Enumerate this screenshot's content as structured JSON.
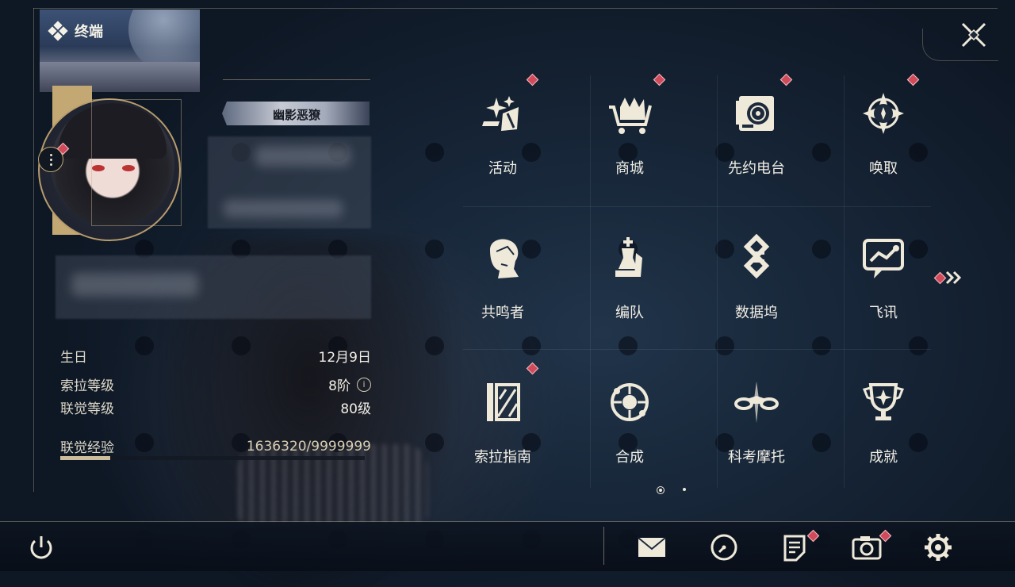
{
  "panel": {
    "title": "终端"
  },
  "profile": {
    "title_plate": "幽影恶獠"
  },
  "stats": [
    {
      "label": "生日",
      "value": "12月9日"
    },
    {
      "label": "索拉等级",
      "value": "8阶"
    },
    {
      "label": "联觉等级",
      "value": "80级"
    },
    {
      "label": "联觉经验",
      "value": "1636320/9999999"
    }
  ],
  "experience": {
    "current": 1636320,
    "max": 9999999
  },
  "menu": [
    {
      "label": "活动",
      "icon": "sparkle-icon",
      "badge": true
    },
    {
      "label": "商城",
      "icon": "shopping-cart-icon",
      "badge": true
    },
    {
      "label": "先约电台",
      "icon": "radio-icon",
      "badge": true
    },
    {
      "label": "唤取",
      "icon": "compass-star-icon",
      "badge": true
    },
    {
      "label": "共鸣者",
      "icon": "character-icon",
      "badge": false
    },
    {
      "label": "编队",
      "icon": "chess-piece-icon",
      "badge": false
    },
    {
      "label": "数据坞",
      "icon": "data-dock-icon",
      "badge": false
    },
    {
      "label": "飞讯",
      "icon": "chat-message-icon",
      "badge": false
    },
    {
      "label": "索拉指南",
      "icon": "guide-book-icon",
      "badge": true
    },
    {
      "label": "合成",
      "icon": "synthesis-icon",
      "badge": false
    },
    {
      "label": "科考摩托",
      "icon": "motorcycle-icon",
      "badge": false
    },
    {
      "label": "成就",
      "icon": "trophy-icon",
      "badge": false
    }
  ],
  "pagination": {
    "current": 1,
    "total": 2
  },
  "colors": {
    "accent_gold": "#c4a874",
    "badge_red": "#d14a5a",
    "text": "#f1eee4"
  },
  "bottom_bar": {
    "icons": [
      "power-icon",
      "mail-icon",
      "clock-icon",
      "notice-icon",
      "camera-icon",
      "settings-gear-icon"
    ]
  }
}
